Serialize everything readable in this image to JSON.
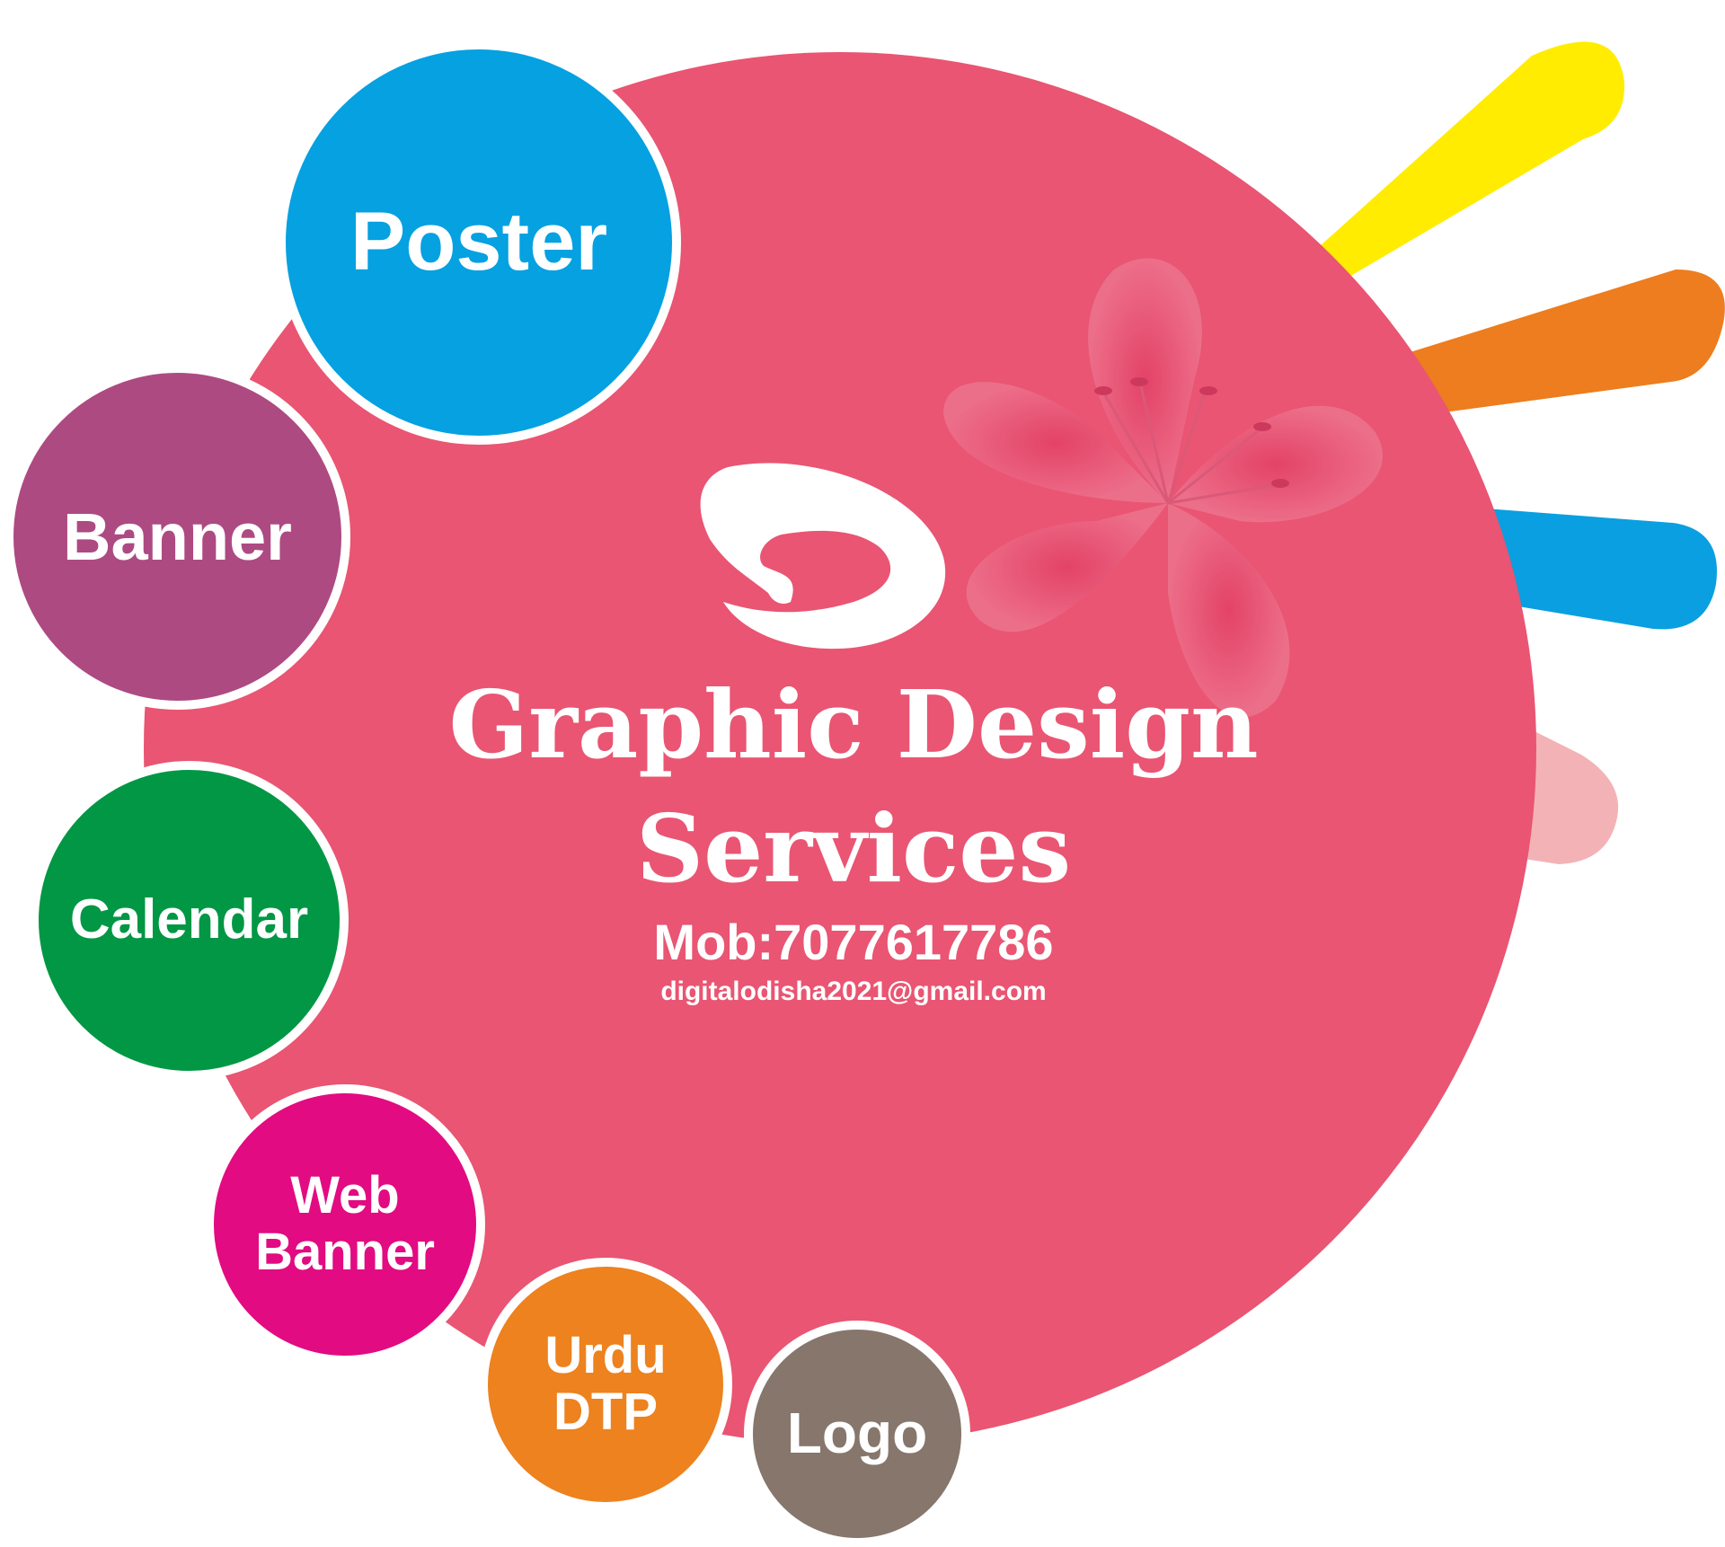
{
  "title": "Graphic Design Services",
  "title_line1": "Graphic Design",
  "title_line2": "Services",
  "mobile": "Mob:7077617786",
  "email": "digitalodisha2021@gmail.com",
  "services": {
    "poster": "Poster",
    "banner": "Banner",
    "calendar": "Calendar",
    "web_banner": [
      "Web",
      "Banner"
    ],
    "urdu_dtp": [
      "Urdu",
      "DTP"
    ],
    "logo": "Logo"
  },
  "colors": {
    "main_circle": "#E95572",
    "poster": "#05A1E1",
    "banner": "#AD4A82",
    "calendar": "#019744",
    "web_banner": "#E20B82",
    "urdu_dtp": "#ED821E",
    "logo": "#86766C",
    "ray_yellow": "#FFEC00",
    "ray_orange": "#ED7D1E",
    "ray_blue": "#0A9FE0",
    "ray_pink": "#F3B3B6",
    "flower": "#EE6F8A"
  },
  "icons": [
    "logo-d-icon",
    "flower-icon"
  ]
}
